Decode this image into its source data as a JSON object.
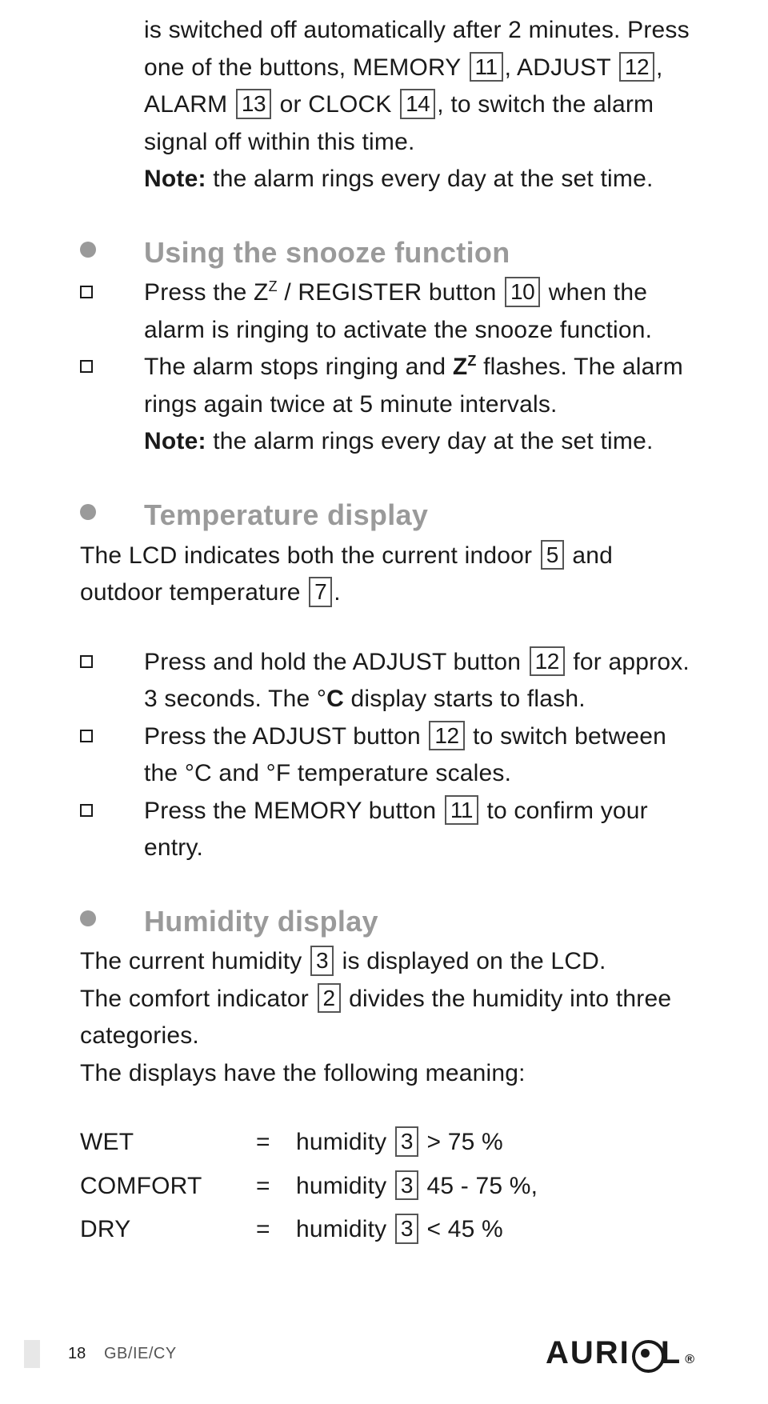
{
  "intro": {
    "p1a": "is switched off automatically after 2 minutes. Press one of the buttons, MEMORY ",
    "b11": "11",
    "p1b": ", ADJUST ",
    "b12": "12",
    "p1c": ", ALARM ",
    "b13": "13",
    "p1d": " or CLOCK ",
    "b14": "14",
    "p1e": ", to switch the alarm signal off within this time.",
    "note_label": "Note:",
    "note_text": " the alarm rings every day at the set time."
  },
  "snooze": {
    "heading": "Using the snooze function",
    "item1a": "Press the Z",
    "item1sup": "Z",
    "item1b": " / REGISTER button ",
    "item1badge": "10",
    "item1c": " when the alarm is ringing to activate the snooze function.",
    "item2a": "The alarm stops ringing and ",
    "item2z": "Z",
    "item2zsup": "Z",
    "item2b": " flashes. The alarm rings again twice at 5 minute intervals.",
    "note_label": "Note:",
    "note_text": " the alarm rings every day at the set time."
  },
  "temp": {
    "heading": "Temperature display",
    "intro_a": "The LCD indicates both the current indoor ",
    "badge5": "5",
    "intro_b": " and outdoor temperature ",
    "badge7": "7",
    "intro_c": ".",
    "i1a": "Press and hold the ADJUST button ",
    "i1badge": "12",
    "i1b": " for approx. 3 seconds. The ",
    "i1deg": "°",
    "i1c": "C",
    "i1d": " display starts to flash.",
    "i2a": "Press the ADJUST button ",
    "i2badge": "12",
    "i2b": " to switch between the °C and °F temperature scales.",
    "i3a": "Press the MEMORY button ",
    "i3badge": "11",
    "i3b": " to confirm your entry."
  },
  "hum": {
    "heading": "Humidity display",
    "p1a": "The current humidity ",
    "badge3": "3",
    "p1b": " is displayed on the LCD.",
    "p2a": "The comfort indicator ",
    "badge2": "2",
    "p2b": " divides the humidity into three categories.",
    "p3": "The displays have the following meaning:",
    "rows": {
      "r1": {
        "label": "WET",
        "eq": "=",
        "pre": "humidity ",
        "badge": "3",
        "post": " > 75 %"
      },
      "r2": {
        "label": "COMFORT",
        "eq": "=",
        "pre": "humidity ",
        "badge": "3",
        "post": " 45 - 75 %,"
      },
      "r3": {
        "label": "DRY",
        "eq": "=",
        "pre": "humidity ",
        "badge": "3",
        "post": " < 45 %"
      }
    }
  },
  "footer": {
    "page": "18",
    "lang": "GB/IE/CY",
    "brand_a": "AURI",
    "brand_b": "L",
    "reg": "®"
  }
}
